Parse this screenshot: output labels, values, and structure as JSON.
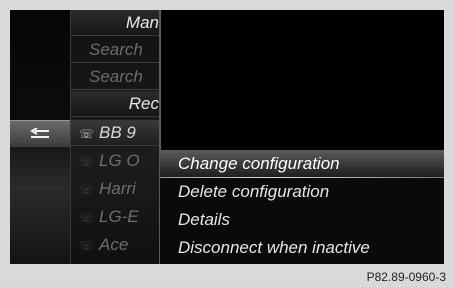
{
  "list": {
    "rows": [
      {
        "text": "Man",
        "kind": "header"
      },
      {
        "text": "Search",
        "kind": "action"
      },
      {
        "text": "Search",
        "kind": "action"
      },
      {
        "text": "Rec",
        "kind": "header"
      },
      {
        "text": "BB 9",
        "kind": "device",
        "icon": "phone-bluetooth-icon"
      },
      {
        "text": "LG O",
        "kind": "device-dim",
        "icon": "phone-bluetooth-icon"
      },
      {
        "text": "Harri",
        "kind": "device-dim",
        "icon": "phone-bluetooth-icon"
      },
      {
        "text": "LG-E",
        "kind": "device-dim",
        "icon": "phone-bluetooth-icon"
      },
      {
        "text": "Ace",
        "kind": "device-dim",
        "icon": "phone-bluetooth-icon"
      }
    ]
  },
  "back_button": {
    "icon": "back-arrow-icon"
  },
  "menu": {
    "items": [
      {
        "label": "Change configuration",
        "selected": true
      },
      {
        "label": "Delete configuration",
        "selected": false
      },
      {
        "label": "Details",
        "selected": false
      },
      {
        "label": "Disconnect when inactive",
        "selected": false
      }
    ]
  },
  "footer": {
    "code": "P82.89-0960-3"
  }
}
